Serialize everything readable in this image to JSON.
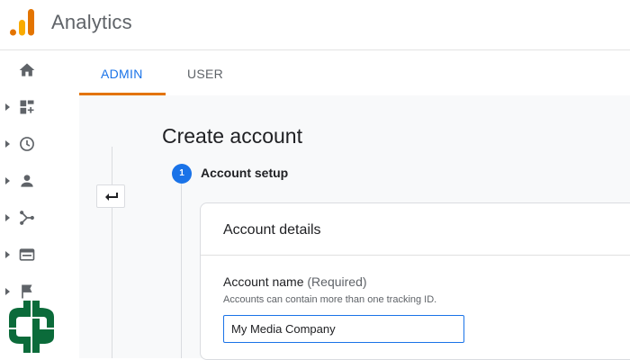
{
  "app": {
    "title": "Analytics",
    "logo_icon": "analytics-logo-icon"
  },
  "sidebar": {
    "items": [
      {
        "icon": "home-icon"
      },
      {
        "icon": "dashboard-add-icon"
      },
      {
        "icon": "clock-icon"
      },
      {
        "icon": "person-icon"
      },
      {
        "icon": "share-nodes-icon"
      },
      {
        "icon": "browser-window-icon"
      },
      {
        "icon": "flag-icon"
      }
    ]
  },
  "tabs": [
    {
      "label": "ADMIN",
      "active": true
    },
    {
      "label": "USER",
      "active": false
    }
  ],
  "page": {
    "back_icon": "back-arrow-icon",
    "title": "Create account",
    "step": {
      "number": "1",
      "label": "Account setup"
    },
    "card": {
      "title": "Account details",
      "field_label": "Account name",
      "field_required": "(Required)",
      "field_help": "Accounts can contain more than one tracking ID.",
      "field_value": "My Media Company"
    }
  },
  "colors": {
    "accent": "#1a73e8",
    "tab_indicator": "#e37400",
    "logo_orange": "#f9ab00",
    "logo_dark": "#e37400",
    "watermark": "#0b6b3a"
  }
}
